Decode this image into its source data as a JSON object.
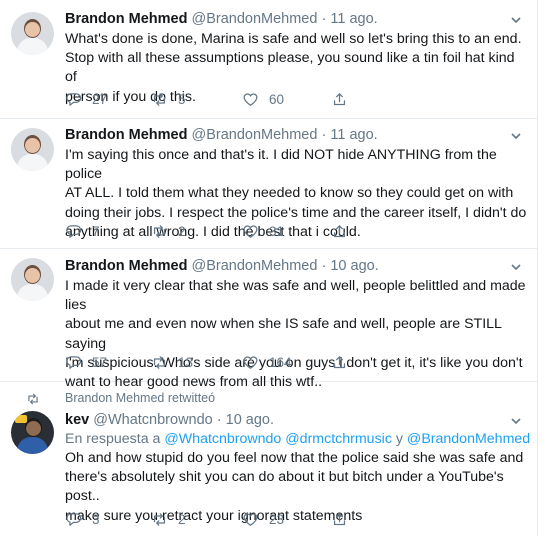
{
  "tweets": [
    {
      "name": "Brandon Mehmed",
      "handle": "@BrandonMehmed",
      "dot": "·",
      "time": "11 ago.",
      "lines": [
        "What's done is done, Marina is safe and well so let's bring this to an end.",
        "Stop with all these assumptions please, you sound like a tin foil hat kind of",
        "person if you do this."
      ],
      "replies": "27",
      "retweets": "5",
      "likes": "60"
    },
    {
      "name": "Brandon Mehmed",
      "handle": "@BrandonMehmed",
      "dot": "·",
      "time": "11 ago.",
      "lines": [
        "I'm saying this once and that's it. I did NOT hide ANYTHING from the police",
        "AT ALL. I told them what they needed to know so they could get on with",
        "doing their jobs. I respect the police's time and the career itself, I didn't do",
        "anything at all wrong. I did the best that i could."
      ],
      "replies": "7",
      "retweets": "2",
      "likes": "31"
    },
    {
      "name": "Brandon Mehmed",
      "handle": "@BrandonMehmed",
      "dot": "·",
      "time": "10 ago.",
      "lines": [
        "I made it very clear that she was safe and well, people belittled and made lies",
        "about me and even now when she IS safe and well, people are STILL saying",
        "I'm suspicious. Who's side are you on guys i don't get it, it's like you don't",
        "want to hear good news from all this wtf.."
      ],
      "replies": "57",
      "retweets": "13",
      "likes": "164"
    },
    {
      "retweeted_by": "Brandon Mehmed retwitteó",
      "name": "kev",
      "handle": "@Whatcnbrowndo",
      "dot": "·",
      "time": "10 ago.",
      "reply_prefix": "En respuesta a",
      "mention_1": "@Whatcnbrowndo",
      "mention_2": "@drmctchrmusic",
      "reply_and": "y",
      "mention_3": "@BrandonMehmed",
      "lines": [
        "Oh and how stupid do you feel now that the police said she was safe and",
        "there's absolutely shit you can do about it but bitch under a YouTube's post..",
        "make sure you retract your ignorant statements"
      ],
      "replies": "3",
      "retweets": "2",
      "likes": "23"
    }
  ],
  "icons": {
    "reply": "reply-icon",
    "retweet": "retweet-icon",
    "like": "heart-icon",
    "share": "share-icon",
    "menu": "chevron-down-icon"
  },
  "colors": {
    "text": "#14171a",
    "muted": "#657786",
    "link": "#1da1f2",
    "divider": "#e6ecf0"
  }
}
